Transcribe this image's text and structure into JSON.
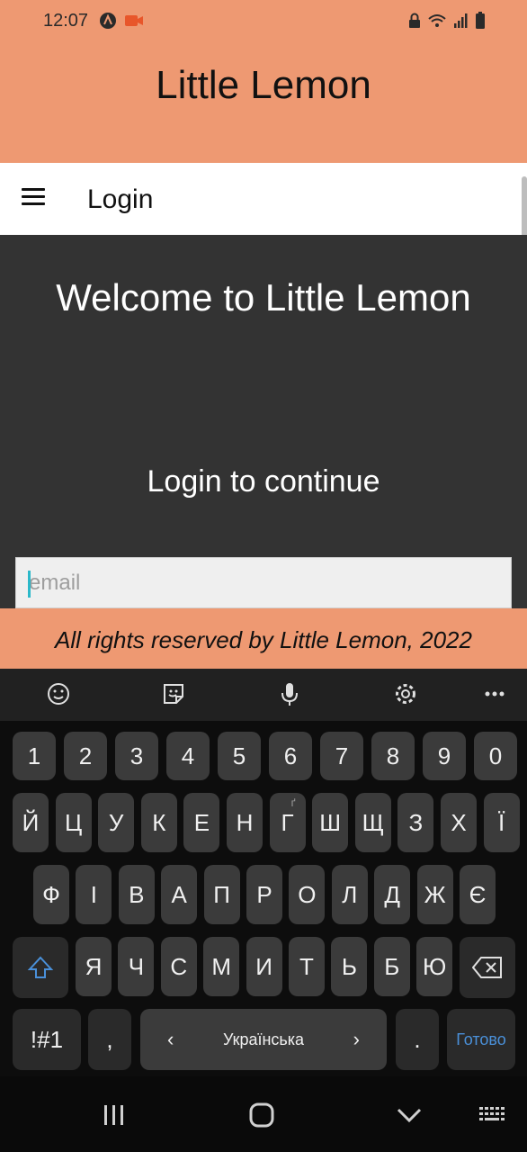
{
  "status": {
    "time": "12:07"
  },
  "app": {
    "title": "Little Lemon"
  },
  "nav": {
    "title": "Login"
  },
  "content": {
    "welcome": "Welcome to Little Lemon",
    "subtitle": "Login to continue",
    "email_placeholder": "email"
  },
  "footer": {
    "text": "All rights reserved by Little Lemon, 2022"
  },
  "keyboard": {
    "toolbar": [
      "emoji-icon",
      "sticker-icon",
      "mic-icon",
      "settings-icon",
      "more-icon"
    ],
    "row_numbers": [
      "1",
      "2",
      "3",
      "4",
      "5",
      "6",
      "7",
      "8",
      "9",
      "0"
    ],
    "row1": [
      "Й",
      "Ц",
      "У",
      "К",
      "Е",
      "Н",
      "Г",
      "Ш",
      "Щ",
      "З",
      "Х",
      "Ї"
    ],
    "row1_sup": {
      "Г": "ґ"
    },
    "row2": [
      "Ф",
      "І",
      "В",
      "А",
      "П",
      "Р",
      "О",
      "Л",
      "Д",
      "Ж",
      "Є"
    ],
    "row3": [
      "Я",
      "Ч",
      "С",
      "М",
      "И",
      "Т",
      "Ь",
      "Б",
      "Ю"
    ],
    "symbols": "!#1",
    "comma": ",",
    "language": "Українська",
    "period": ".",
    "done": "Готово"
  },
  "colors": {
    "brand": "#ee9972",
    "content_bg": "#333333",
    "done": "#4a90d9"
  }
}
